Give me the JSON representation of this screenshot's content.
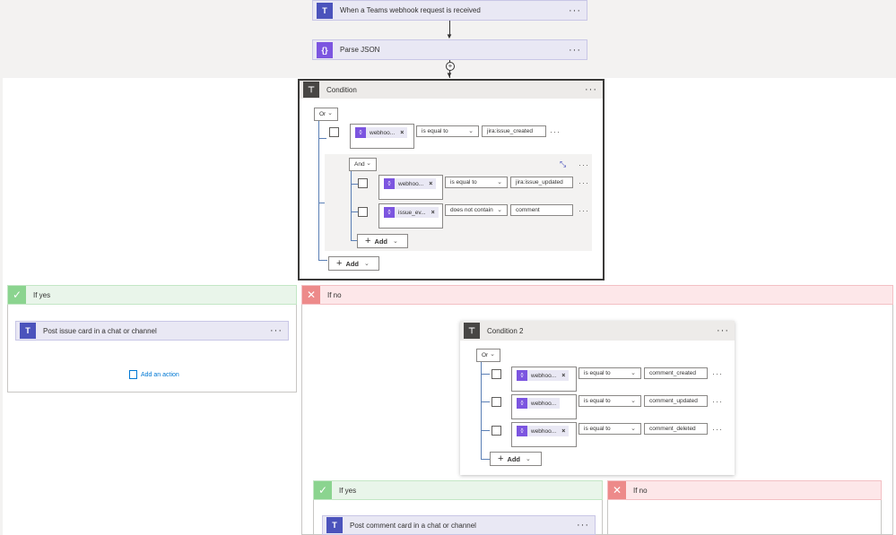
{
  "trigger": {
    "label": "When a Teams webhook request is received",
    "icon": "teams-icon"
  },
  "parse": {
    "label": "Parse JSON",
    "icon": "parse-json-icon"
  },
  "condition": {
    "label": "Condition",
    "group_op": "Or",
    "row1": {
      "token": "webhoo...",
      "op": "is equal to",
      "value": "jira:issue_created"
    },
    "and_group": {
      "op": "And",
      "rows": [
        {
          "token": "webhoo...",
          "op": "is equal to",
          "value": "jira:issue_updated"
        },
        {
          "token": "issue_ev...",
          "op": "does not contain",
          "value": "comment"
        }
      ],
      "add": "Add"
    },
    "add": "Add"
  },
  "if_yes": {
    "label": "If yes",
    "action": "Post issue card in a chat or channel",
    "add_action": "Add an action"
  },
  "if_no": {
    "label": "If no"
  },
  "condition2": {
    "label": "Condition 2",
    "group_op": "Or",
    "rows": [
      {
        "token": "webhoo...",
        "op": "is equal to",
        "value": "comment_created"
      },
      {
        "token": "webhoo...",
        "op": "is equal to",
        "value": "comment_updated"
      },
      {
        "token": "webhoo...",
        "op": "is equal to",
        "value": "comment_deleted"
      }
    ],
    "add": "Add"
  },
  "if_yes2": {
    "label": "If yes",
    "action": "Post comment card in a chat or channel"
  },
  "if_no2": {
    "label": "If no"
  },
  "colors": {
    "teams": "#4b53bc",
    "parse": "#7c55e0",
    "connector": "#5b7fb5",
    "yes": "#8bd48f",
    "no": "#ed8a8a"
  }
}
